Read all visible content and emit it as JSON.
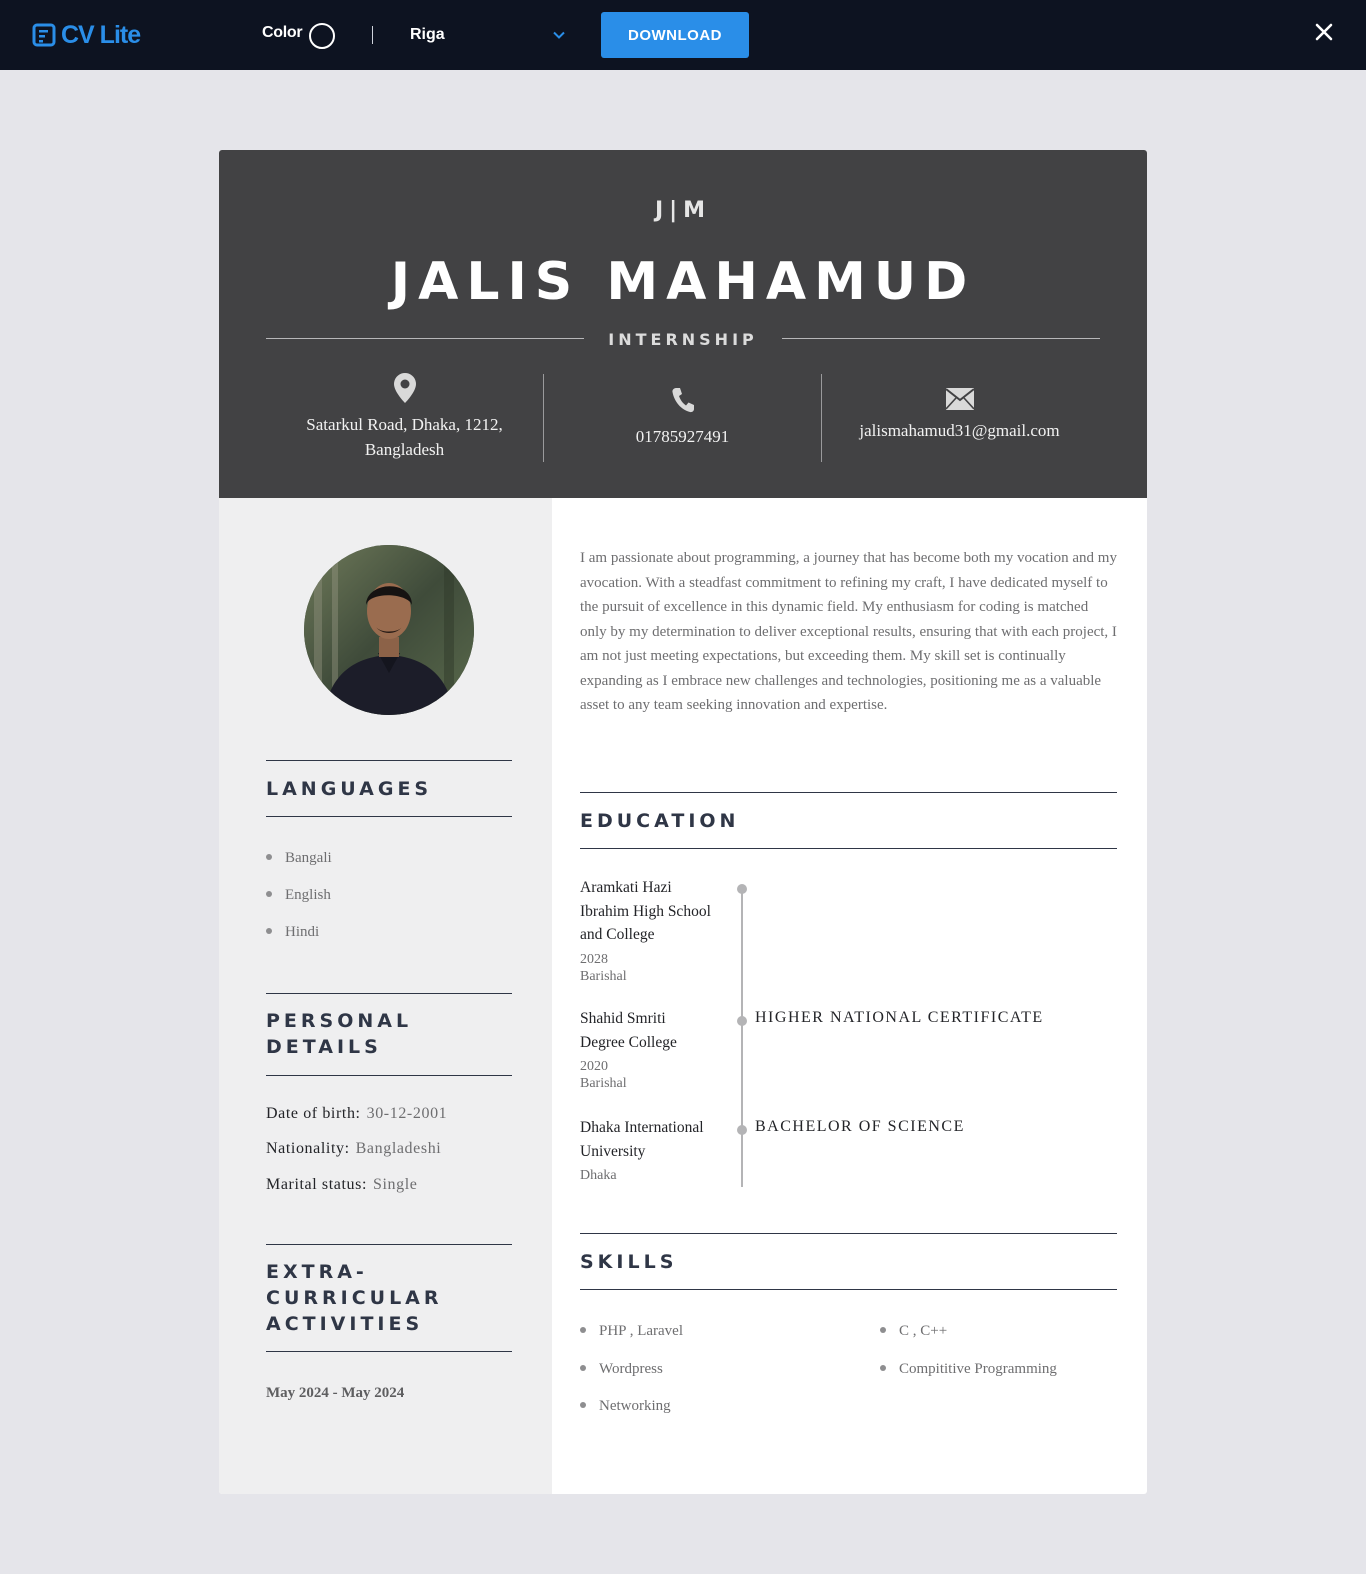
{
  "toolbar": {
    "brand": "CV Lite",
    "color_label": "Color",
    "template_selected": "Riga",
    "download_label": "DOWNLOAD"
  },
  "resume": {
    "initials": "J|M",
    "name": "JALIS MAHAMUD",
    "title": "INTERNSHIP",
    "address_line1": "Satarkul Road, Dhaka, 1212,",
    "address_line2": "Bangladesh",
    "phone": "01785927491",
    "email": "jalismahamud31@gmail.com",
    "summary": "I am passionate about programming, a journey that has become both my vocation and my avocation. With a steadfast commitment to refining my craft, I have dedicated myself to the pursuit of excellence in this dynamic field. My enthusiasm for coding is matched only by my determination to deliver exceptional results, ensuring that with each project, I am not just meeting expectations, but exceeding them. My skill set is continually expanding as I embrace new challenges and technologies, positioning me as a valuable asset to any team seeking innovation and expertise.",
    "sections": {
      "languages": "LANGUAGES",
      "personal_line1": "PERSONAL",
      "personal_line2": "DETAILS",
      "extra_line1": "EXTRA-",
      "extra_line2": "CURRICULAR",
      "extra_line3": "ACTIVITIES",
      "education": "EDUCATION",
      "skills": "SKILLS"
    },
    "languages": [
      "Bangali",
      "English",
      "Hindi"
    ],
    "personal": {
      "dob_label": "Date of birth:",
      "dob": "30-12-2001",
      "nationality_label": "Nationality:",
      "nationality": "Bangladeshi",
      "marital_label": "Marital status:",
      "marital": "Single"
    },
    "extra": {
      "date": "May 2024 - May 2024"
    },
    "education": [
      {
        "school_l1": "Aramkati Hazi",
        "school_l2": "Ibrahim High School",
        "school_l3": "and College",
        "year": "2028",
        "city": "Barishal",
        "degree": ""
      },
      {
        "school_l1": "Shahid Smriti",
        "school_l2": "Degree College",
        "year": "2020",
        "city": "Barishal",
        "degree": "HIGHER NATIONAL CERTIFICATE"
      },
      {
        "school_l1": "Dhaka International",
        "school_l2": "University",
        "city": "Dhaka",
        "degree": "BACHELOR OF SCIENCE"
      }
    ],
    "skills_col1": [
      "PHP , Laravel",
      "Wordpress",
      "Networking"
    ],
    "skills_col2": [
      "C , C++",
      "Compititive Programming"
    ]
  },
  "colors": {
    "topbar": "#0d1321",
    "accent": "#2a8ee8",
    "header": "#424244",
    "sidebar": "#efeff0",
    "heading": "#2f3646"
  }
}
